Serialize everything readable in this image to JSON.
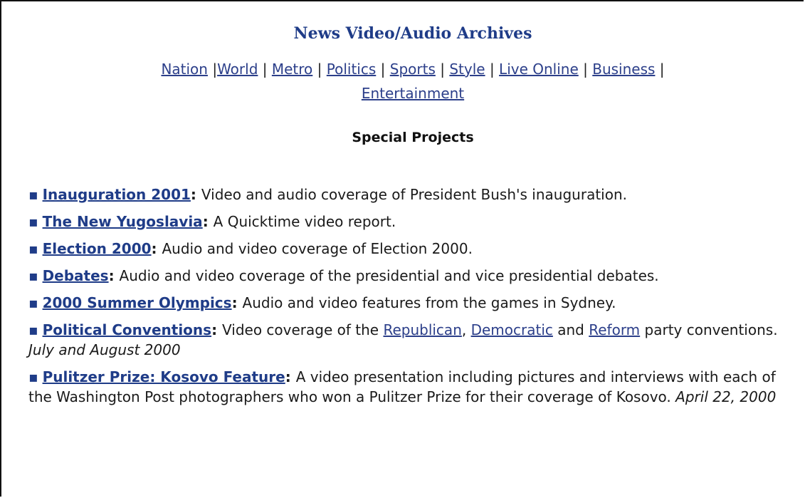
{
  "page": {
    "title": "News Video/Audio Archives",
    "nav": [
      {
        "label": "Nation"
      },
      {
        "label": "World"
      },
      {
        "label": "Metro"
      },
      {
        "label": "Politics"
      },
      {
        "label": "Sports"
      },
      {
        "label": "Style"
      },
      {
        "label": "Live Online"
      },
      {
        "label": "Business"
      },
      {
        "label": "Entertainment"
      }
    ],
    "section_heading": "Special Projects",
    "bullet": "▪",
    "items": [
      {
        "title": "Inauguration 2001",
        "desc": "Video and audio coverage of President Bush's inauguration."
      },
      {
        "title": "The New Yugoslavia",
        "desc": "A Quicktime video report."
      },
      {
        "title": "Election 2000",
        "desc": "Audio and video coverage of Election 2000."
      },
      {
        "title": "Debates",
        "desc": "Audio and video coverage of the presidential and vice presidential debates."
      },
      {
        "title": "2000 Summer Olympics",
        "desc": "Audio and video features from the games in Sydney."
      },
      {
        "title": "Political Conventions",
        "desc_prefix": "Video coverage of the ",
        "link1": "Republican",
        "sep1": ", ",
        "link2": "Democratic",
        "sep2": " and ",
        "link3": "Reform",
        "desc_suffix": " party conventions. ",
        "date": "July and August 2000"
      },
      {
        "title": "Pulitzer Prize: Kosovo Feature",
        "desc": "A video presentation including pictures and interviews with each of the Washington Post photographers who won a Pulitzer Prize for their coverage of Kosovo. ",
        "date": "April 22, 2000"
      }
    ]
  },
  "colors": {
    "link": "#1f3c88",
    "text": "#1a1a1a",
    "border": "#111111"
  }
}
